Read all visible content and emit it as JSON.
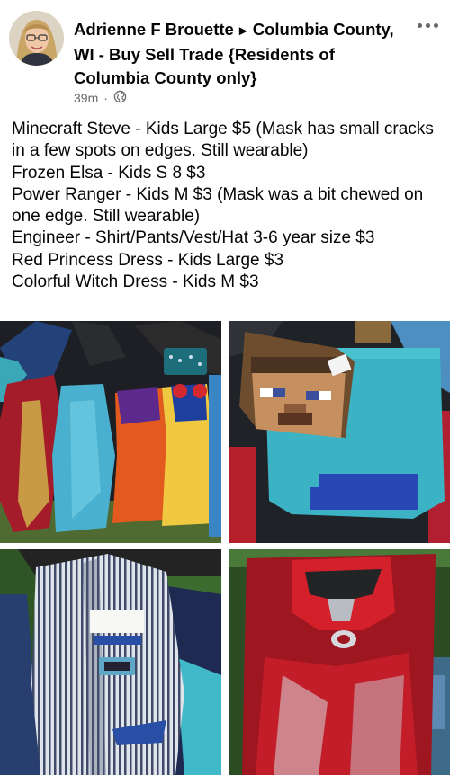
{
  "post": {
    "author": "Adrienne F Brouette",
    "group": "Columbia County, WI - Buy Sell Trade {Residents of Columbia County only}",
    "timestamp": "39m",
    "separator": "·",
    "privacy_icon": "globe-icon",
    "more_icon": "more-options-icon",
    "lines": [
      "Minecraft Steve - Kids Large $5 (Mask has small cracks in a few spots on edges. Still wearable)",
      "Frozen Elsa - Kids S 8 $3",
      "Power Ranger - Kids M $3 (Mask was a bit chewed on one edge. Still wearable)",
      "Engineer - Shirt/Pants/Vest/Hat 3-6 year size $3",
      "Red Princess Dress - Kids Large $3",
      "Colorful Witch Dress - Kids M $3"
    ]
  },
  "photos": [
    {
      "subject": "costumes-laid-out-photo"
    },
    {
      "subject": "minecraft-steve-costume-photo"
    },
    {
      "subject": "engineer-vest-costume-photo"
    },
    {
      "subject": "power-ranger-costume-photo"
    }
  ],
  "colors": {
    "text": "#050505",
    "meta": "#65676b",
    "background": "#ffffff"
  }
}
